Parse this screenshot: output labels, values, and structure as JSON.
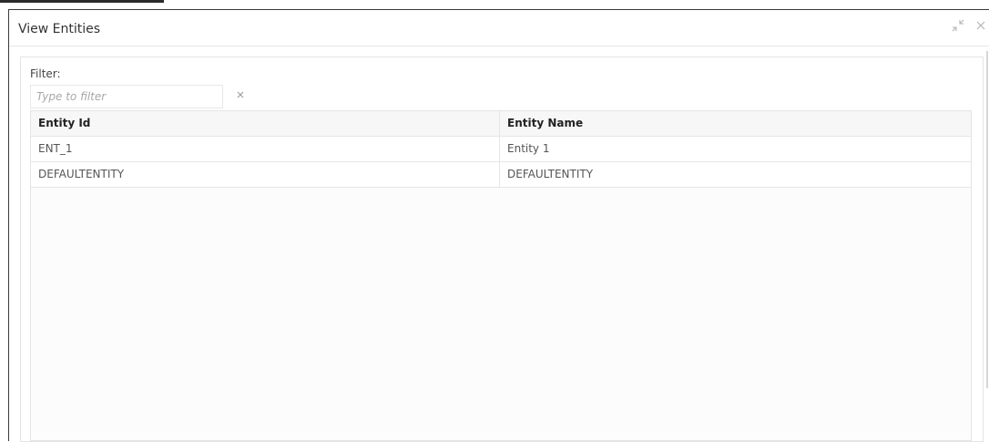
{
  "dialog": {
    "title": "View Entities",
    "minimize_icon": "minimize-arrows-icon",
    "close_icon": "close-icon"
  },
  "filter": {
    "label": "Filter:",
    "placeholder": "Type to filter",
    "value": "",
    "clear_icon": "clear-x-icon"
  },
  "table": {
    "columns": [
      "Entity Id",
      "Entity Name"
    ],
    "rows": [
      [
        "ENT_1",
        "Entity 1"
      ],
      [
        "DEFAULTENTITY",
        "DEFAULTENTITY"
      ]
    ]
  }
}
